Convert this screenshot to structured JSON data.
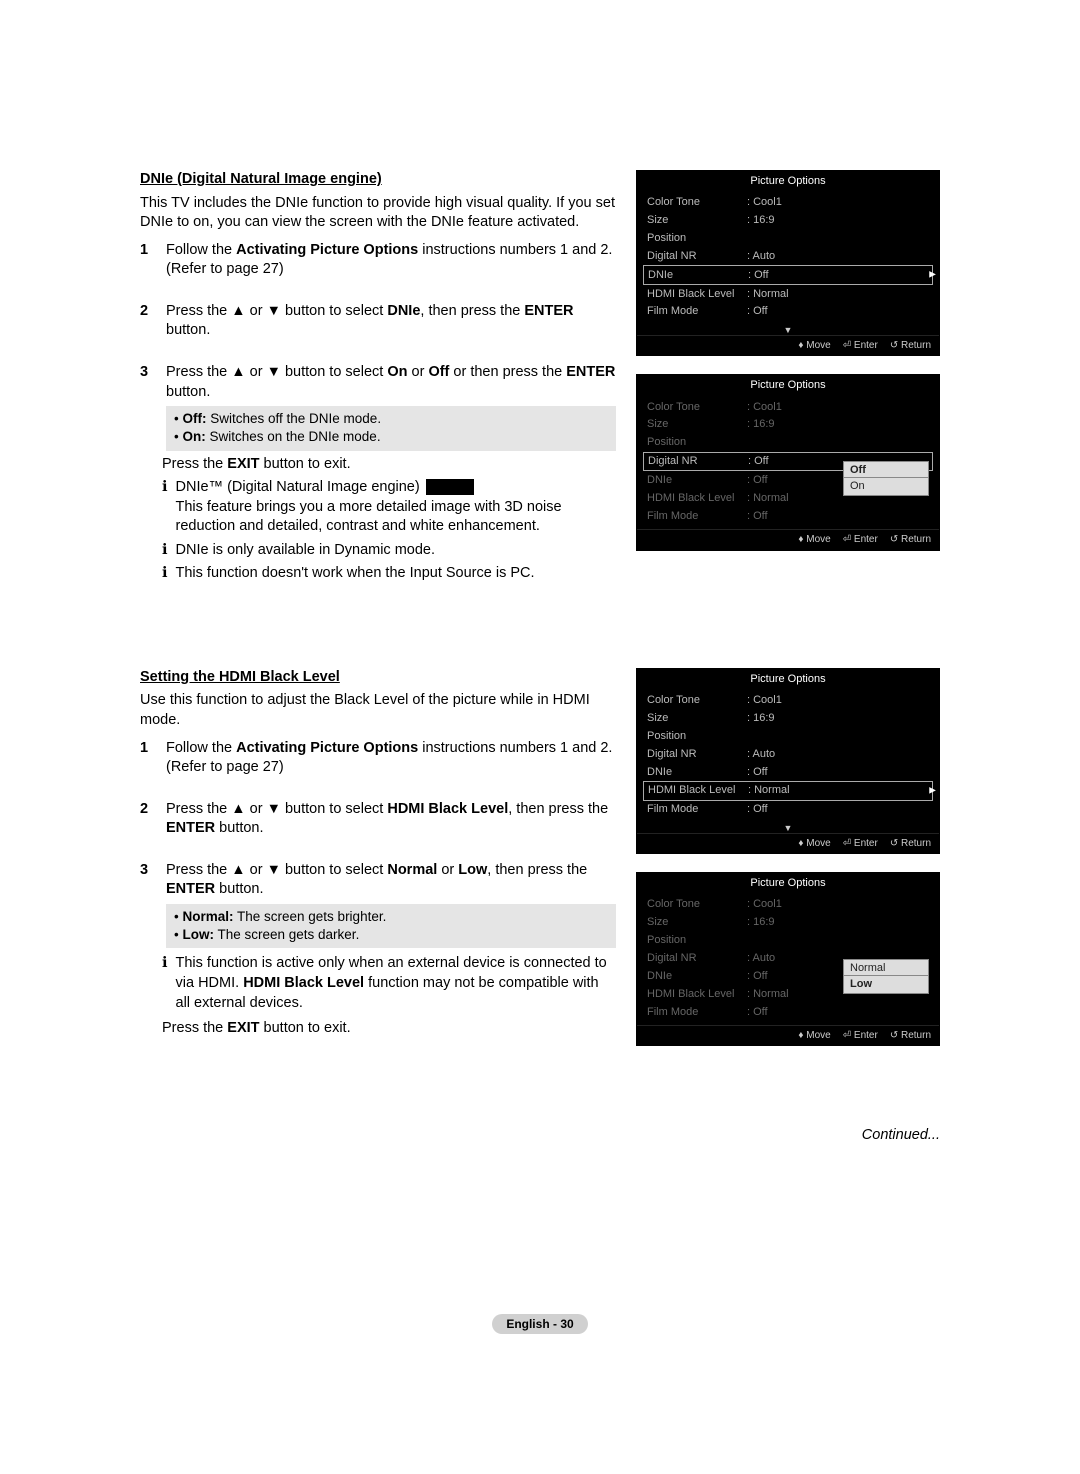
{
  "glyph": {
    "up": "▲",
    "down": "▼",
    "right": "►",
    "updown": "♦",
    "enter": "⏎",
    "return": "↺"
  },
  "sec1": {
    "title": "DNIe (Digital Natural Image engine)",
    "intro": "This TV includes the DNIe function to provide high visual quality. If you set DNIe to on, you can view the screen with the DNIe feature activated.",
    "step1_pre": "Follow the ",
    "step1_bold": "Activating Picture Options",
    "step1_post": " instructions numbers 1 and 2. (Refer to page 27)",
    "step2_pre": "Press the ▲ or ▼ button to select ",
    "step2_b1": "DNIe",
    "step2_mid": ", then press the ",
    "step2_b2": "ENTER",
    "step2_post": " button.",
    "step3_pre": "Press the ▲ or ▼ button to select ",
    "step3_b1": "On",
    "step3_mid1": " or ",
    "step3_b2": "Off",
    "step3_mid2": " or then press the ",
    "step3_b3": "ENTER",
    "step3_post": " button.",
    "grey1_b": "Off:",
    "grey1_t": " Switches off the DNIe mode.",
    "grey2_b": "On:",
    "grey2_t": " Switches on the DNIe mode.",
    "exit_pre": "Press the ",
    "exit_b": "EXIT",
    "exit_post": " button to exit.",
    "note1_a": "DNIe™ (Digital Natural Image engine)",
    "note1_b": "This feature brings you a more detailed image with 3D noise reduction and detailed, contrast and white enhancement.",
    "note2": "DNIe is only available in Dynamic mode.",
    "note3": "This function doesn't work when the Input Source is PC."
  },
  "sec2": {
    "title": "Setting the HDMI Black Level",
    "intro": "Use this function to adjust the Black Level of the picture while in HDMI mode.",
    "step1_pre": "Follow the ",
    "step1_bold": "Activating Picture Options",
    "step1_post": " instructions numbers 1 and 2. (Refer to page 27)",
    "step2_pre": "Press the ▲ or ▼ button to select ",
    "step2_b1": "HDMI Black Level",
    "step2_mid": ", then press the ",
    "step2_b2": "ENTER",
    "step2_post": " button.",
    "step3_pre": "Press the ▲ or ▼ button to select ",
    "step3_b1": "Normal",
    "step3_mid1": " or ",
    "step3_b2": "Low",
    "step3_mid2": ", then press the ",
    "step3_b3": "ENTER",
    "step3_post": " button.",
    "grey1_b": "Normal:",
    "grey1_t": " The screen gets brighter.",
    "grey2_b": "Low:",
    "grey2_t": " The screen gets darker.",
    "note1_a": "This function is active only when an external device is connected to via HDMI. ",
    "note1_b1": "HDMI Black Level",
    "note1_c": " function may not be compatible with all external devices.",
    "exit_pre": "Press the ",
    "exit_b": "EXIT",
    "exit_post": " button to exit."
  },
  "osd": {
    "title": "Picture Options",
    "foot_move": "Move",
    "foot_enter": "Enter",
    "foot_return": "Return",
    "rows_base": [
      {
        "label": "Color Tone",
        "value": ": Cool1"
      },
      {
        "label": "Size",
        "value": ": 16:9"
      },
      {
        "label": "Position",
        "value": ""
      },
      {
        "label": "Digital NR",
        "value": ": Auto"
      },
      {
        "label": "DNIe",
        "value": ": Off"
      },
      {
        "label": "HDMI Black Level",
        "value": ": Normal"
      },
      {
        "label": "Film Mode",
        "value": ": Off"
      }
    ],
    "m1_sel_index": 4,
    "m2": {
      "sel_label_index": 3,
      "sel_label_value": ": Off",
      "popup_top_row": 4,
      "popup_items": [
        "Off",
        "On"
      ],
      "popup_sel": 0
    },
    "m3_sel_index": 5,
    "m4": {
      "popup_top_row": 4,
      "popup_items": [
        "Normal",
        "Low"
      ],
      "popup_sel": 1
    }
  },
  "continued": "Continued...",
  "footer": "English - 30"
}
